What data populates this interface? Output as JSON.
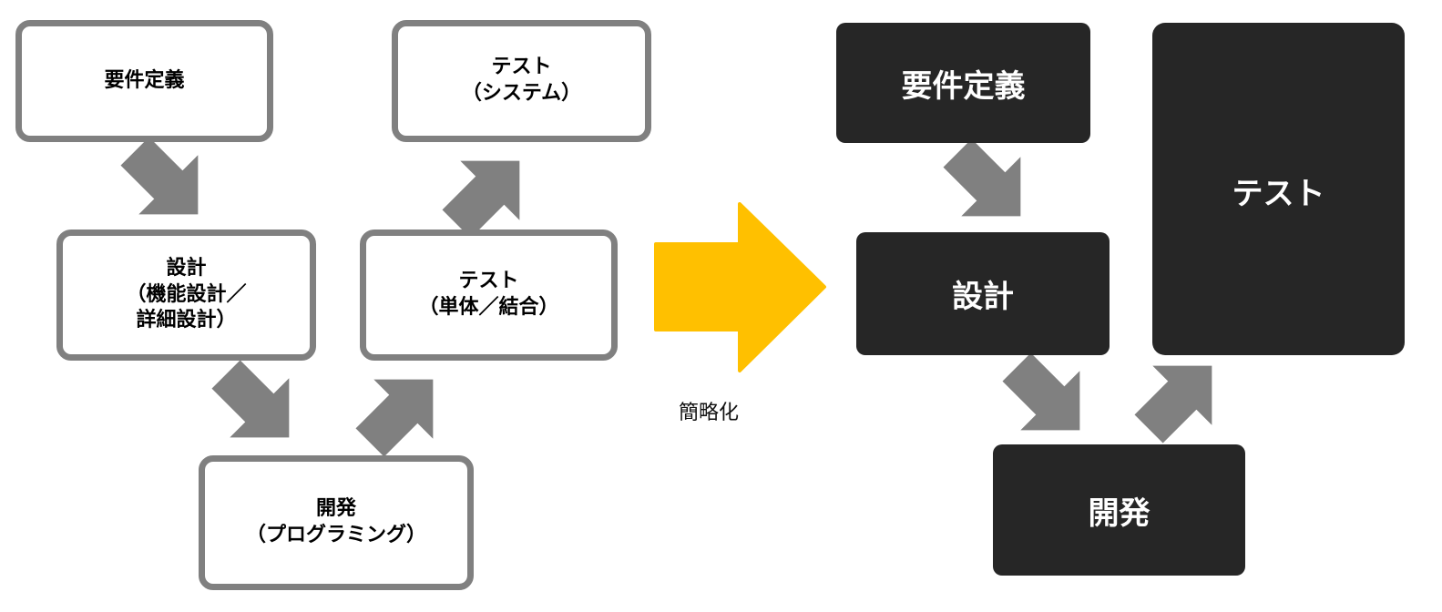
{
  "before": {
    "requirements": "要件定義",
    "design": "設計\n（機能設計／\n詳細設計）",
    "development": "開発\n（プログラミング）",
    "unit_test": "テスト\n（単体／結合）",
    "system_test": "テスト\n（システム）"
  },
  "transition_label": "簡略化",
  "after": {
    "requirements": "要件定義",
    "design": "設計",
    "development": "開発",
    "test": "テスト"
  },
  "colors": {
    "arrow_gray": "#808080",
    "box_border": "#808080",
    "highlight_arrow": "#FFC000",
    "dark_box": "#262626"
  }
}
